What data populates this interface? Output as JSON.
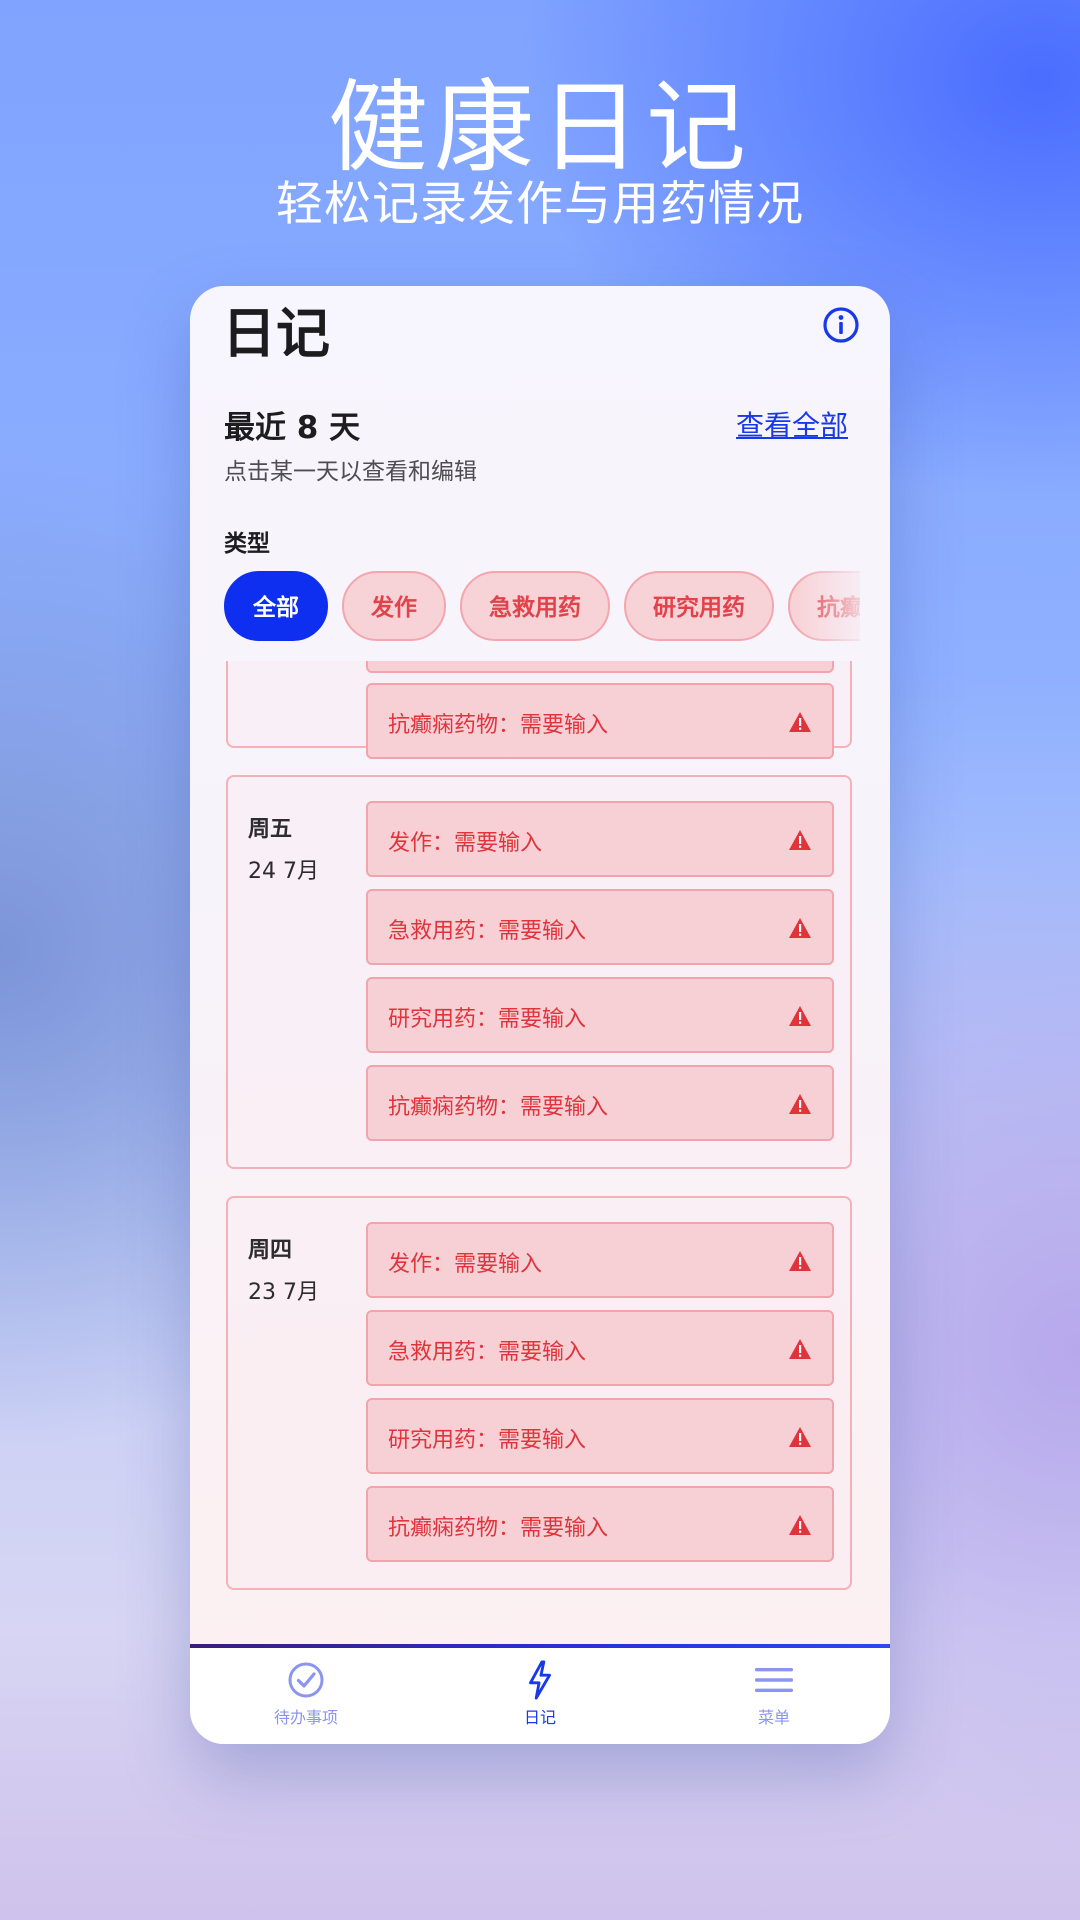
{
  "hero": {
    "title": "健康日记",
    "subtitle": "轻松记录发作与用药情况"
  },
  "header": {
    "title": "日记",
    "info_icon": "info-icon"
  },
  "section": {
    "title": "最近 8 天",
    "view_all": "查看全部",
    "hint": "点击某一天以查看和编辑"
  },
  "filter": {
    "label": "类型",
    "chips": [
      "全部",
      "发作",
      "急救用药",
      "研究用药",
      "抗癫痫药物"
    ],
    "active": "全部"
  },
  "days": [
    {
      "name": "",
      "date": "",
      "entries": [
        "抗癫痫药物：需要输入"
      ]
    },
    {
      "name": "周五",
      "date": "24 7月",
      "entries": [
        "发作：需要输入",
        "急救用药：需要输入",
        "研究用药：需要输入",
        "抗癫痫药物：需要输入"
      ]
    },
    {
      "name": "周四",
      "date": "23 7月",
      "entries": [
        "发作：需要输入",
        "急救用药：需要输入",
        "研究用药：需要输入",
        "抗癫痫药物：需要输入"
      ]
    }
  ],
  "nav": {
    "items": [
      {
        "label": "待办事项",
        "icon": "check-circle-icon"
      },
      {
        "label": "日记",
        "icon": "lightning-icon"
      },
      {
        "label": "菜单",
        "icon": "menu-icon"
      }
    ],
    "active": "日记"
  },
  "colors": {
    "accent": "#0f2ff0",
    "warning": "#e0343d",
    "chip_inactive_bg": "#f7d2d6",
    "nav_inactive": "#8b95f0"
  }
}
